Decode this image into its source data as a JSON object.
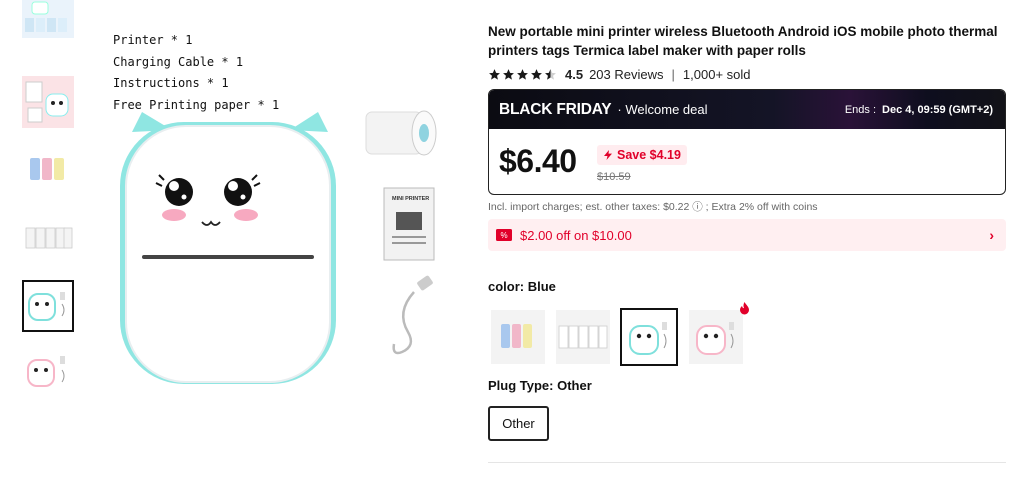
{
  "contents": [
    "Printer * 1",
    "Charging Cable * 1",
    "Instructions * 1",
    "Free Printing paper * 1"
  ],
  "product": {
    "title": "New portable mini printer wireless Bluetooth Android iOS mobile photo thermal printers tags Termica label maker with paper rolls",
    "rating": "4.5",
    "reviews": "203 Reviews",
    "sold": "1,000+ sold"
  },
  "deal": {
    "banner": "BLACK FRIDAY",
    "sub": "· Welcome deal",
    "ends_label": "Ends :",
    "ends_value": "Dec 4, 09:59 (GMT+2)",
    "price": "$6.40",
    "save": "Save $4.19",
    "original": "$10.59"
  },
  "tax_note": "Incl. import charges; est. other taxes: $0.22 ⓘ ; Extra 2% off with coins",
  "coupon": {
    "text": "$2.00 off on $10.00",
    "chevron": "›"
  },
  "color": {
    "label": "color: Blue"
  },
  "plug": {
    "label": "Plug Type: Other",
    "option": "Other"
  },
  "colors": {
    "accent": "#e1002a",
    "teal": "#7fe0dc"
  }
}
